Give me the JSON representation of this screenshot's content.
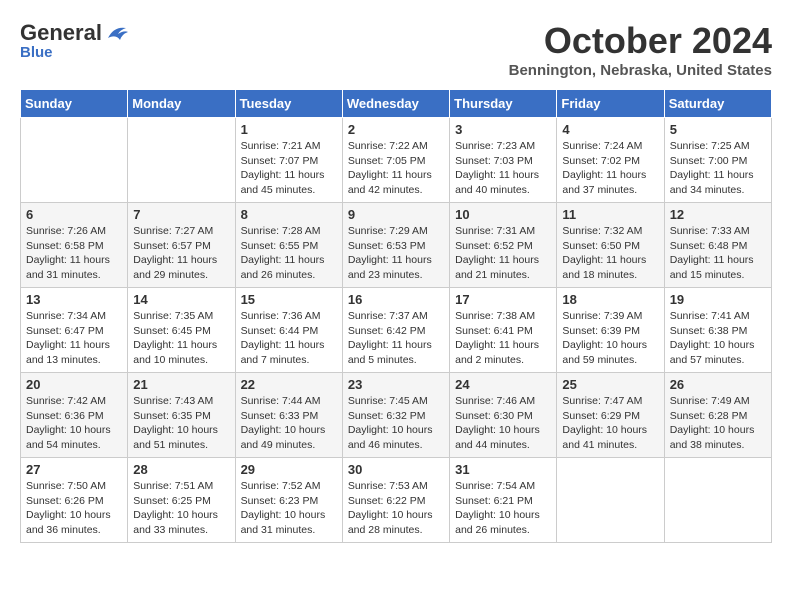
{
  "header": {
    "logo_general": "General",
    "logo_blue": "Blue",
    "title": "October 2024",
    "location": "Bennington, Nebraska, United States"
  },
  "days_of_week": [
    "Sunday",
    "Monday",
    "Tuesday",
    "Wednesday",
    "Thursday",
    "Friday",
    "Saturday"
  ],
  "weeks": [
    {
      "shaded": false,
      "days": [
        {
          "num": "",
          "sunrise": "",
          "sunset": "",
          "daylight": ""
        },
        {
          "num": "",
          "sunrise": "",
          "sunset": "",
          "daylight": ""
        },
        {
          "num": "1",
          "sunrise": "Sunrise: 7:21 AM",
          "sunset": "Sunset: 7:07 PM",
          "daylight": "Daylight: 11 hours and 45 minutes."
        },
        {
          "num": "2",
          "sunrise": "Sunrise: 7:22 AM",
          "sunset": "Sunset: 7:05 PM",
          "daylight": "Daylight: 11 hours and 42 minutes."
        },
        {
          "num": "3",
          "sunrise": "Sunrise: 7:23 AM",
          "sunset": "Sunset: 7:03 PM",
          "daylight": "Daylight: 11 hours and 40 minutes."
        },
        {
          "num": "4",
          "sunrise": "Sunrise: 7:24 AM",
          "sunset": "Sunset: 7:02 PM",
          "daylight": "Daylight: 11 hours and 37 minutes."
        },
        {
          "num": "5",
          "sunrise": "Sunrise: 7:25 AM",
          "sunset": "Sunset: 7:00 PM",
          "daylight": "Daylight: 11 hours and 34 minutes."
        }
      ]
    },
    {
      "shaded": true,
      "days": [
        {
          "num": "6",
          "sunrise": "Sunrise: 7:26 AM",
          "sunset": "Sunset: 6:58 PM",
          "daylight": "Daylight: 11 hours and 31 minutes."
        },
        {
          "num": "7",
          "sunrise": "Sunrise: 7:27 AM",
          "sunset": "Sunset: 6:57 PM",
          "daylight": "Daylight: 11 hours and 29 minutes."
        },
        {
          "num": "8",
          "sunrise": "Sunrise: 7:28 AM",
          "sunset": "Sunset: 6:55 PM",
          "daylight": "Daylight: 11 hours and 26 minutes."
        },
        {
          "num": "9",
          "sunrise": "Sunrise: 7:29 AM",
          "sunset": "Sunset: 6:53 PM",
          "daylight": "Daylight: 11 hours and 23 minutes."
        },
        {
          "num": "10",
          "sunrise": "Sunrise: 7:31 AM",
          "sunset": "Sunset: 6:52 PM",
          "daylight": "Daylight: 11 hours and 21 minutes."
        },
        {
          "num": "11",
          "sunrise": "Sunrise: 7:32 AM",
          "sunset": "Sunset: 6:50 PM",
          "daylight": "Daylight: 11 hours and 18 minutes."
        },
        {
          "num": "12",
          "sunrise": "Sunrise: 7:33 AM",
          "sunset": "Sunset: 6:48 PM",
          "daylight": "Daylight: 11 hours and 15 minutes."
        }
      ]
    },
    {
      "shaded": false,
      "days": [
        {
          "num": "13",
          "sunrise": "Sunrise: 7:34 AM",
          "sunset": "Sunset: 6:47 PM",
          "daylight": "Daylight: 11 hours and 13 minutes."
        },
        {
          "num": "14",
          "sunrise": "Sunrise: 7:35 AM",
          "sunset": "Sunset: 6:45 PM",
          "daylight": "Daylight: 11 hours and 10 minutes."
        },
        {
          "num": "15",
          "sunrise": "Sunrise: 7:36 AM",
          "sunset": "Sunset: 6:44 PM",
          "daylight": "Daylight: 11 hours and 7 minutes."
        },
        {
          "num": "16",
          "sunrise": "Sunrise: 7:37 AM",
          "sunset": "Sunset: 6:42 PM",
          "daylight": "Daylight: 11 hours and 5 minutes."
        },
        {
          "num": "17",
          "sunrise": "Sunrise: 7:38 AM",
          "sunset": "Sunset: 6:41 PM",
          "daylight": "Daylight: 11 hours and 2 minutes."
        },
        {
          "num": "18",
          "sunrise": "Sunrise: 7:39 AM",
          "sunset": "Sunset: 6:39 PM",
          "daylight": "Daylight: 10 hours and 59 minutes."
        },
        {
          "num": "19",
          "sunrise": "Sunrise: 7:41 AM",
          "sunset": "Sunset: 6:38 PM",
          "daylight": "Daylight: 10 hours and 57 minutes."
        }
      ]
    },
    {
      "shaded": true,
      "days": [
        {
          "num": "20",
          "sunrise": "Sunrise: 7:42 AM",
          "sunset": "Sunset: 6:36 PM",
          "daylight": "Daylight: 10 hours and 54 minutes."
        },
        {
          "num": "21",
          "sunrise": "Sunrise: 7:43 AM",
          "sunset": "Sunset: 6:35 PM",
          "daylight": "Daylight: 10 hours and 51 minutes."
        },
        {
          "num": "22",
          "sunrise": "Sunrise: 7:44 AM",
          "sunset": "Sunset: 6:33 PM",
          "daylight": "Daylight: 10 hours and 49 minutes."
        },
        {
          "num": "23",
          "sunrise": "Sunrise: 7:45 AM",
          "sunset": "Sunset: 6:32 PM",
          "daylight": "Daylight: 10 hours and 46 minutes."
        },
        {
          "num": "24",
          "sunrise": "Sunrise: 7:46 AM",
          "sunset": "Sunset: 6:30 PM",
          "daylight": "Daylight: 10 hours and 44 minutes."
        },
        {
          "num": "25",
          "sunrise": "Sunrise: 7:47 AM",
          "sunset": "Sunset: 6:29 PM",
          "daylight": "Daylight: 10 hours and 41 minutes."
        },
        {
          "num": "26",
          "sunrise": "Sunrise: 7:49 AM",
          "sunset": "Sunset: 6:28 PM",
          "daylight": "Daylight: 10 hours and 38 minutes."
        }
      ]
    },
    {
      "shaded": false,
      "days": [
        {
          "num": "27",
          "sunrise": "Sunrise: 7:50 AM",
          "sunset": "Sunset: 6:26 PM",
          "daylight": "Daylight: 10 hours and 36 minutes."
        },
        {
          "num": "28",
          "sunrise": "Sunrise: 7:51 AM",
          "sunset": "Sunset: 6:25 PM",
          "daylight": "Daylight: 10 hours and 33 minutes."
        },
        {
          "num": "29",
          "sunrise": "Sunrise: 7:52 AM",
          "sunset": "Sunset: 6:23 PM",
          "daylight": "Daylight: 10 hours and 31 minutes."
        },
        {
          "num": "30",
          "sunrise": "Sunrise: 7:53 AM",
          "sunset": "Sunset: 6:22 PM",
          "daylight": "Daylight: 10 hours and 28 minutes."
        },
        {
          "num": "31",
          "sunrise": "Sunrise: 7:54 AM",
          "sunset": "Sunset: 6:21 PM",
          "daylight": "Daylight: 10 hours and 26 minutes."
        },
        {
          "num": "",
          "sunrise": "",
          "sunset": "",
          "daylight": ""
        },
        {
          "num": "",
          "sunrise": "",
          "sunset": "",
          "daylight": ""
        }
      ]
    }
  ]
}
